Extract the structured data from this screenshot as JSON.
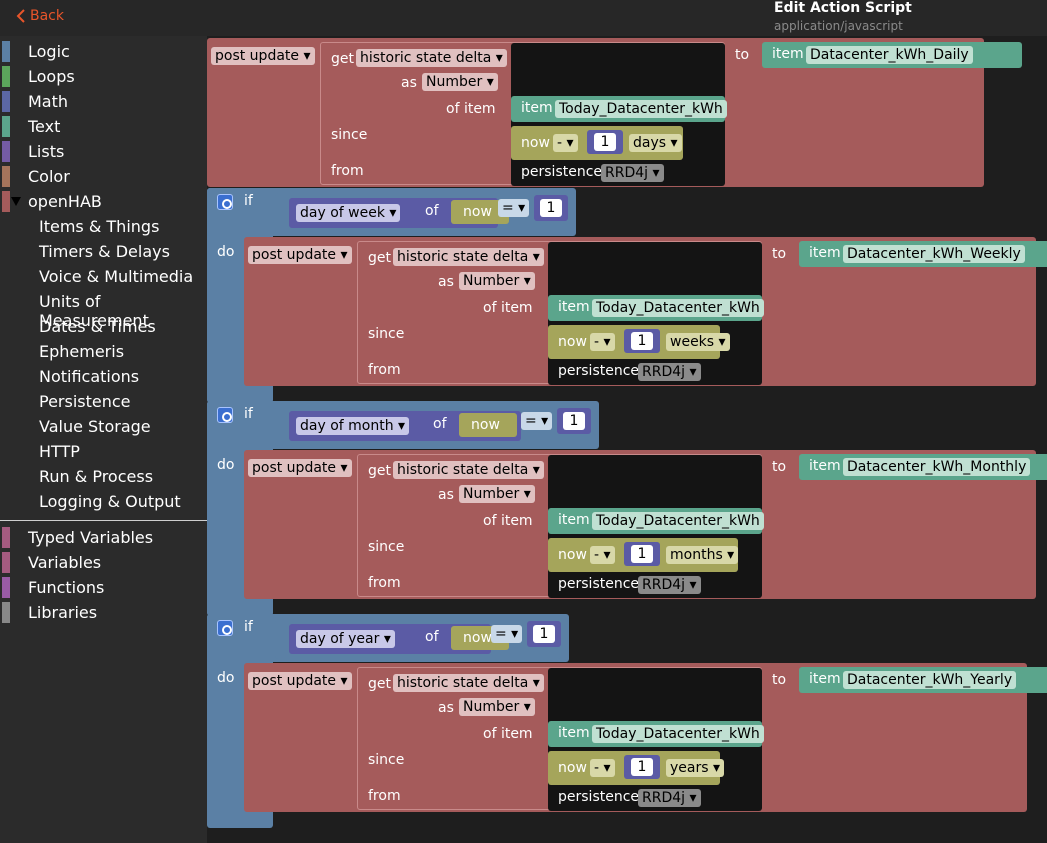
{
  "header": {
    "back_label": "Back",
    "title": "Edit Action Script",
    "subtitle": "application/javascript"
  },
  "toolbox": {
    "categories": [
      {
        "label": "Logic",
        "color": "#5b80a5"
      },
      {
        "label": "Loops",
        "color": "#5ba55b"
      },
      {
        "label": "Math",
        "color": "#5b67a5"
      },
      {
        "label": "Text",
        "color": "#5ba58c"
      },
      {
        "label": "Lists",
        "color": "#745ba5"
      },
      {
        "label": "Color",
        "color": "#a5745b"
      },
      {
        "label": "openHAB",
        "color": "#a55b5b"
      }
    ],
    "openhab_sub": [
      "Items & Things",
      "Timers & Delays",
      "Voice & Multimedia",
      "Units of Measurement",
      "Dates & Times",
      "Ephemeris",
      "Notifications",
      "Persistence",
      "Value Storage",
      "HTTP",
      "Run & Process",
      "Logging & Output"
    ],
    "bottom": [
      {
        "label": "Typed Variables",
        "color": "#a55b80"
      },
      {
        "label": "Variables",
        "color": "#a55b80"
      },
      {
        "label": "Functions",
        "color": "#995ba5"
      },
      {
        "label": "Libraries",
        "color": "#888888"
      }
    ]
  },
  "blocks": {
    "post_update": "post update",
    "get": "get",
    "historic_state_delta": "historic state delta",
    "as": "as",
    "number_type": "Number",
    "of_item": "of item",
    "since": "since",
    "from": "from",
    "to": "to",
    "item_kw": "item",
    "source_item": "Today_Datacenter_kWh",
    "now": "now",
    "minus": "-",
    "one": "1",
    "persistence": "persistence",
    "service": "RRD4j",
    "if": "if",
    "do": "do",
    "of": "of",
    "equals": "=",
    "daily": {
      "target": "Datacenter_kWh_Daily",
      "unit": "days"
    },
    "weekly": {
      "cond": "day of week",
      "target": "Datacenter_kWh_Weekly",
      "unit": "weeks"
    },
    "monthly": {
      "cond": "day of month",
      "target": "Datacenter_kWh_Monthly",
      "unit": "months"
    },
    "yearly": {
      "cond": "day of year",
      "target": "Datacenter_kWh_Yearly",
      "unit": "years"
    }
  }
}
